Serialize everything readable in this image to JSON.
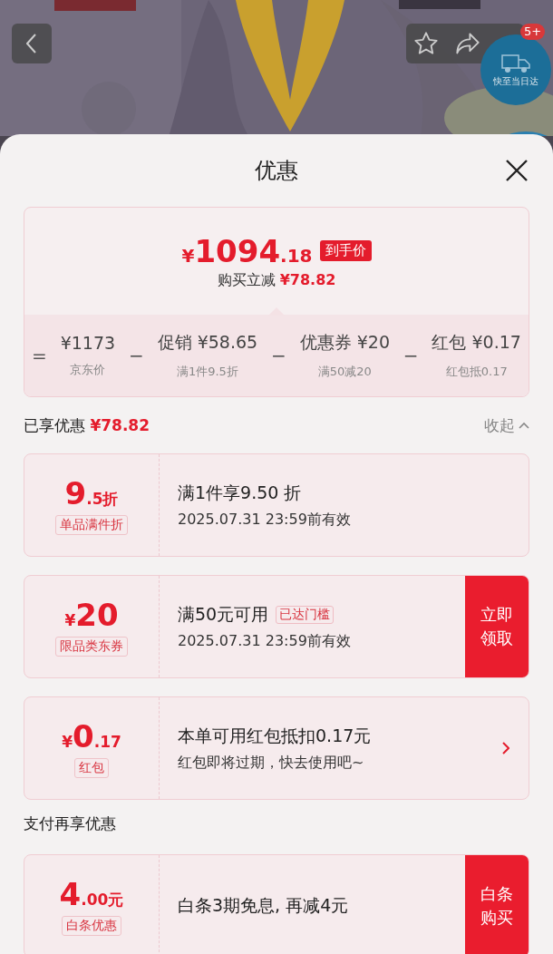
{
  "header": {
    "cart_badge": "5+",
    "delivery_badge": "快至当日达"
  },
  "sheet": {
    "title": "优惠",
    "summary": {
      "currency": "¥",
      "integer": "1094",
      "decimal": ".18",
      "tag": "到手价",
      "saving_label": "购买立减",
      "saving_amount": "¥78.82",
      "breakdown": [
        {
          "operator": "=",
          "amount": "¥1173",
          "note": "京东价"
        },
        {
          "operator": "−",
          "label": "促销",
          "amount": "¥58.65",
          "note": "满1件9.5折"
        },
        {
          "operator": "−",
          "label": "优惠券",
          "amount": "¥20",
          "note": "满50减20"
        },
        {
          "operator": "−",
          "label": "红包",
          "amount": "¥0.17",
          "note": "红包抵0.17"
        }
      ]
    },
    "enjoyed": {
      "label": "已享优惠",
      "amount": "¥78.82",
      "toggle": "收起",
      "expanded": true
    },
    "coupons": [
      {
        "main": "9",
        "suffix": ".5折",
        "tag": "单品满件折",
        "title": "满1件享9.50 折",
        "subtitle": "2025.07.31 23:59前有效",
        "kind": "plain"
      },
      {
        "prefix": "¥",
        "main": "20",
        "tag": "限品类东券",
        "title": "满50元可用",
        "title_badge": "已达门槛",
        "subtitle": "2025.07.31 23:59前有效",
        "kind": "action",
        "action": "立即领取"
      },
      {
        "prefix": "¥",
        "main": "0",
        "suffix": ".17",
        "tag": "红包",
        "title": "本单可用红包抵扣0.17元",
        "subtitle": "红包即将过期，快去使用吧~",
        "kind": "arrow"
      }
    ],
    "pay_section": "支付再享优惠",
    "pay_coupons": [
      {
        "main": "4",
        "suffix": ".00元",
        "tag": "白条优惠",
        "title": "白条3期免息, 再减4元",
        "kind": "action",
        "action": "白条购买"
      }
    ]
  }
}
